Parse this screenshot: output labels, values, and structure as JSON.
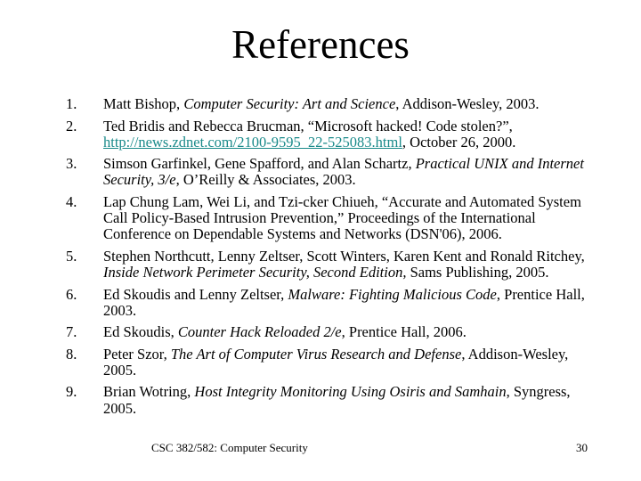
{
  "slide": {
    "title": "References",
    "references": [
      {
        "num": "1.",
        "parts": [
          {
            "t": "Matt Bishop, "
          },
          {
            "t": "Computer Security: Art and Science",
            "i": true
          },
          {
            "t": ", Addison-Wesley, 2003."
          }
        ]
      },
      {
        "num": "2.",
        "parts": [
          {
            "t": "Ted Bridis and Rebecca Brucman, “Microsoft hacked!  Code stolen?”, "
          },
          {
            "t": "http://news.zdnet.com/2100-9595_22-525083.html",
            "link": true
          },
          {
            "t": ", October 26, 2000."
          }
        ]
      },
      {
        "num": "3.",
        "parts": [
          {
            "t": "Simson Garfinkel, Gene Spafford, and Alan Schartz, "
          },
          {
            "t": "Practical UNIX and Internet Security, 3/e",
            "i": true
          },
          {
            "t": ", O’Reilly & Associates, 2003."
          }
        ]
      },
      {
        "num": "4.",
        "parts": [
          {
            "t": "Lap Chung Lam, Wei Li, and Tzi-cker Chiueh, “Accurate and Automated System Call Policy-Based Intrusion Prevention,” Proceedings of the International Conference on Dependable Systems and Networks (DSN'06), 2006."
          }
        ]
      },
      {
        "num": "5.",
        "parts": [
          {
            "t": "Stephen Northcutt, Lenny Zeltser, Scott Winters, Karen Kent and Ronald Ritchey, "
          },
          {
            "t": "Inside Network Perimeter Security, Second Edition,",
            "i": true
          },
          {
            "t": " Sams Publishing, 2005."
          }
        ]
      },
      {
        "num": "6.",
        "parts": [
          {
            "t": "Ed Skoudis and Lenny Zeltser, "
          },
          {
            "t": "Malware: Fighting Malicious Code",
            "i": true
          },
          {
            "t": ", Prentice Hall, 2003."
          }
        ]
      },
      {
        "num": "7.",
        "parts": [
          {
            "t": "Ed Skoudis, "
          },
          {
            "t": "Counter Hack Reloaded 2/e",
            "i": true
          },
          {
            "t": ", Prentice Hall, 2006."
          }
        ]
      },
      {
        "num": "8.",
        "parts": [
          {
            "t": "Peter Szor, "
          },
          {
            "t": "The Art of Computer Virus Research and Defense",
            "i": true
          },
          {
            "t": ", Addison-Wesley, 2005."
          }
        ]
      },
      {
        "num": "9.",
        "parts": [
          {
            "t": "Brian Wotring, "
          },
          {
            "t": "Host Integrity Monitoring Using Osiris and Samhain",
            "i": true
          },
          {
            "t": ", Syngress, 2005."
          }
        ]
      }
    ],
    "footer": "CSC 382/582: Computer Security",
    "page_number": "30",
    "link_color": "#1a8a8a"
  }
}
